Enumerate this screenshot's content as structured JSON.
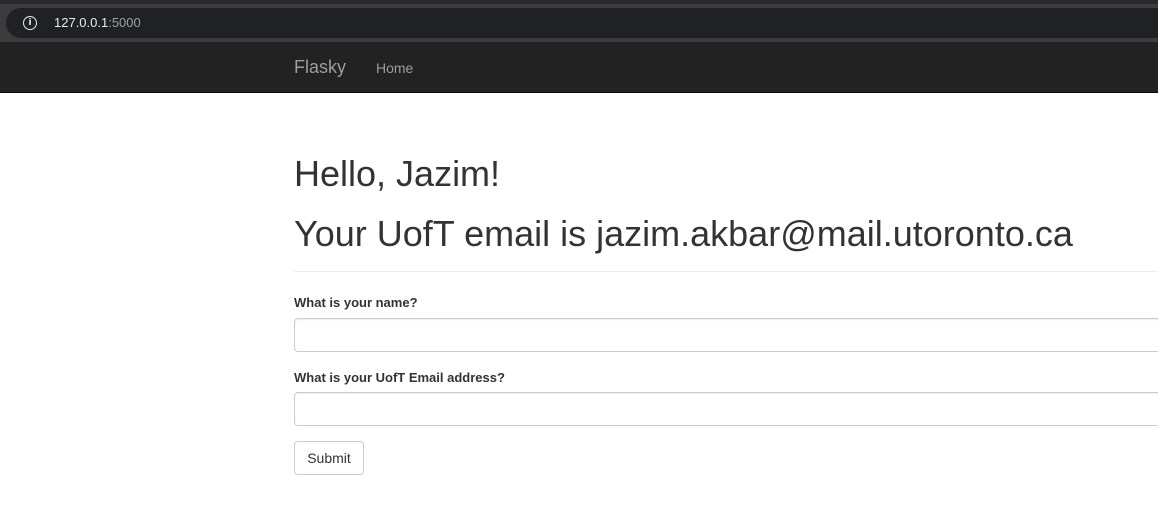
{
  "browser": {
    "url_host": "127.0.0.1",
    "url_port": ":5000",
    "info_icon": "info-icon"
  },
  "navbar": {
    "brand": "Flasky",
    "links": [
      {
        "label": "Home"
      }
    ]
  },
  "main": {
    "greeting": "Hello, Jazim!",
    "email_message": "Your UofT email is jazim.akbar@mail.utoronto.ca",
    "form": {
      "name_label": "What is your name?",
      "name_value": "",
      "email_label": "What is your UofT Email address?",
      "email_value": "",
      "submit_label": "Submit"
    }
  }
}
